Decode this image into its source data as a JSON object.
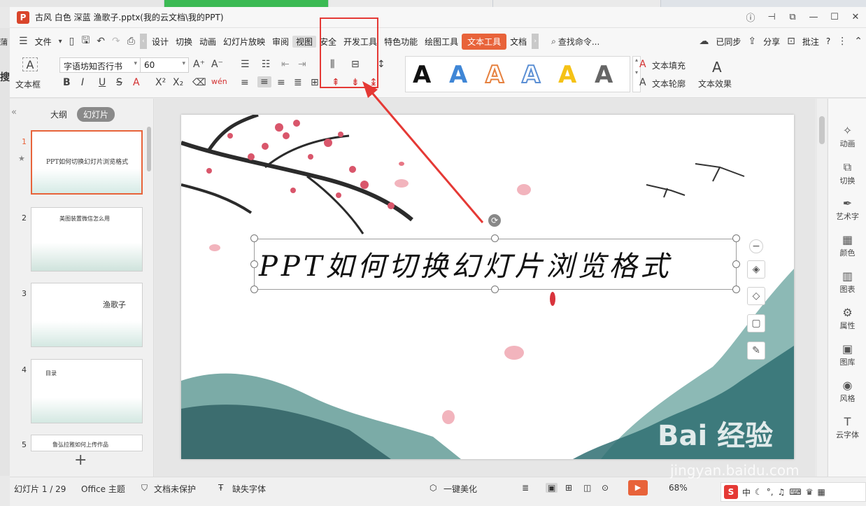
{
  "window": {
    "doc_title": "古风 白色 深蓝 渔歌子.pptx(我的云文档\\我的PPT)",
    "app_logo": "P"
  },
  "menu": {
    "file": "文件",
    "items": [
      "设计",
      "切换",
      "动画",
      "幻灯片放映",
      "审阅",
      "视图",
      "安全",
      "开发工具",
      "特色功能",
      "绘图工具",
      "文本工具",
      "文档"
    ],
    "search": "查找命令...",
    "synced": "已同步",
    "share": "分享",
    "annotate": "批注",
    "help": "?"
  },
  "ribbon": {
    "textbox_label": "文本框",
    "font_name": "字语坊知否行书",
    "font_size": "60",
    "wordart_letters": [
      "A",
      "A",
      "A",
      "A",
      "A",
      "A"
    ],
    "text_fill": "文本填充",
    "text_outline": "文本轮廓",
    "text_effect": "文本效果"
  },
  "left_panel": {
    "tab_outline": "大纲",
    "tab_slides": "幻灯片",
    "thumbnails": [
      {
        "num": "1",
        "title": "PPT如何切换幻灯片浏览格式"
      },
      {
        "num": "2",
        "title": "美图装置微信怎么用"
      },
      {
        "num": "3",
        "title": "渔歌子"
      },
      {
        "num": "4",
        "title": "目录"
      },
      {
        "num": "5",
        "title": "鲁弘拉雅如何上传作品"
      }
    ],
    "add": "+"
  },
  "slide": {
    "title": "PPT如何切换幻灯片浏览格式"
  },
  "right_panel": {
    "items": [
      "动画",
      "切换",
      "艺术字",
      "颜色",
      "图表",
      "属性",
      "图库",
      "风格",
      "云字体"
    ]
  },
  "status": {
    "slide_count": "幻灯片 1 / 29",
    "theme": "Office 主题",
    "unprotected": "文档未保护",
    "missing_font": "缺失字体",
    "beautify": "一键美化",
    "zoom": "68%"
  },
  "ime": {
    "lang": "中",
    "logo": "S"
  },
  "watermark": {
    "brand": "Bai  经验",
    "url": "jingyan.baidu.com"
  },
  "left_edge": [
    "蒲",
    "搜"
  ],
  "colors": {
    "accent": "#e8633a",
    "highlight": "#e53935"
  }
}
